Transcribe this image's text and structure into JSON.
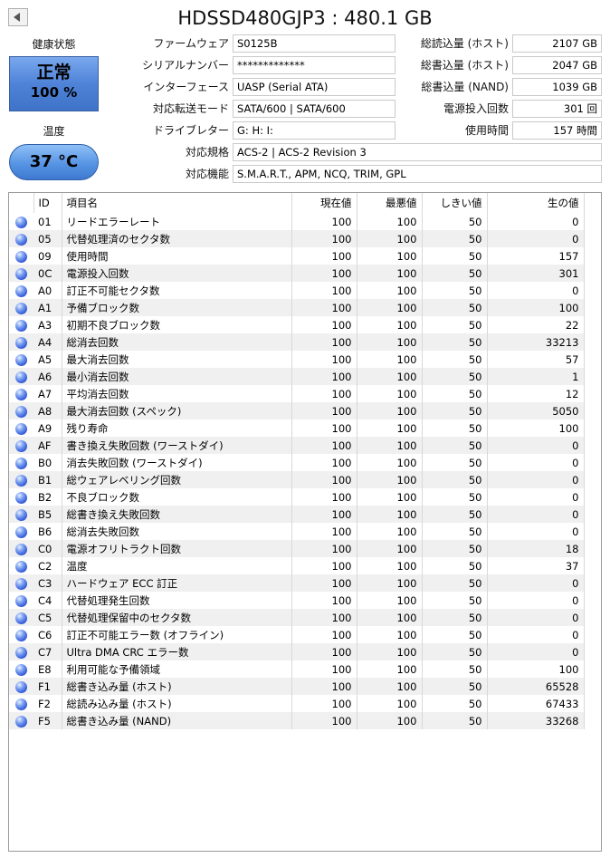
{
  "title": "HDSSD480GJP3 : 480.1 GB",
  "health": {
    "label": "健康状態",
    "status": "正常",
    "percent": "100 %",
    "color": "#4f83d8"
  },
  "temperature": {
    "label": "温度",
    "value": "37 °C",
    "color": "#5794e4"
  },
  "info": {
    "firmware": {
      "label": "ファームウェア",
      "value": "S0125B"
    },
    "serial": {
      "label": "シリアルナンバー",
      "value": "*************"
    },
    "interface": {
      "label": "インターフェース",
      "value": "UASP (Serial ATA)"
    },
    "transfer_mode": {
      "label": "対応転送モード",
      "value": "SATA/600 | SATA/600"
    },
    "drive_letter": {
      "label": "ドライブレター",
      "value": "G: H: I:"
    },
    "standard": {
      "label": "対応規格",
      "value": "ACS-2 | ACS-2 Revision 3"
    },
    "features": {
      "label": "対応機能",
      "value": "S.M.A.R.T., APM, NCQ, TRIM, GPL"
    }
  },
  "stats": {
    "host_reads": {
      "label": "総読込量 (ホスト)",
      "value": "2107 GB"
    },
    "host_writes": {
      "label": "総書込量 (ホスト)",
      "value": "2047 GB"
    },
    "nand_writes": {
      "label": "総書込量 (NAND)",
      "value": "1039 GB"
    },
    "power_on_count": {
      "label": "電源投入回数",
      "value": "301 回"
    },
    "power_on_hours": {
      "label": "使用時間",
      "value": "157 時間"
    }
  },
  "smart": {
    "headers": {
      "id": "ID",
      "name": "項目名",
      "current": "現在値",
      "worst": "最悪値",
      "threshold": "しきい値",
      "raw": "生の値"
    },
    "status_icon": "blue-circle-icon",
    "rows": [
      {
        "id": "01",
        "name": "リードエラーレート",
        "current": "100",
        "worst": "100",
        "threshold": "50",
        "raw": "0"
      },
      {
        "id": "05",
        "name": "代替処理済のセクタ数",
        "current": "100",
        "worst": "100",
        "threshold": "50",
        "raw": "0"
      },
      {
        "id": "09",
        "name": "使用時間",
        "current": "100",
        "worst": "100",
        "threshold": "50",
        "raw": "157"
      },
      {
        "id": "0C",
        "name": "電源投入回数",
        "current": "100",
        "worst": "100",
        "threshold": "50",
        "raw": "301"
      },
      {
        "id": "A0",
        "name": "訂正不可能セクタ数",
        "current": "100",
        "worst": "100",
        "threshold": "50",
        "raw": "0"
      },
      {
        "id": "A1",
        "name": "予備ブロック数",
        "current": "100",
        "worst": "100",
        "threshold": "50",
        "raw": "100"
      },
      {
        "id": "A3",
        "name": "初期不良ブロック数",
        "current": "100",
        "worst": "100",
        "threshold": "50",
        "raw": "22"
      },
      {
        "id": "A4",
        "name": "総消去回数",
        "current": "100",
        "worst": "100",
        "threshold": "50",
        "raw": "33213"
      },
      {
        "id": "A5",
        "name": "最大消去回数",
        "current": "100",
        "worst": "100",
        "threshold": "50",
        "raw": "57"
      },
      {
        "id": "A6",
        "name": "最小消去回数",
        "current": "100",
        "worst": "100",
        "threshold": "50",
        "raw": "1"
      },
      {
        "id": "A7",
        "name": "平均消去回数",
        "current": "100",
        "worst": "100",
        "threshold": "50",
        "raw": "12"
      },
      {
        "id": "A8",
        "name": "最大消去回数 (スペック)",
        "current": "100",
        "worst": "100",
        "threshold": "50",
        "raw": "5050"
      },
      {
        "id": "A9",
        "name": "残り寿命",
        "current": "100",
        "worst": "100",
        "threshold": "50",
        "raw": "100"
      },
      {
        "id": "AF",
        "name": "書き換え失敗回数 (ワーストダイ)",
        "current": "100",
        "worst": "100",
        "threshold": "50",
        "raw": "0"
      },
      {
        "id": "B0",
        "name": "消去失敗回数 (ワーストダイ)",
        "current": "100",
        "worst": "100",
        "threshold": "50",
        "raw": "0"
      },
      {
        "id": "B1",
        "name": "総ウェアレベリング回数",
        "current": "100",
        "worst": "100",
        "threshold": "50",
        "raw": "0"
      },
      {
        "id": "B2",
        "name": "不良ブロック数",
        "current": "100",
        "worst": "100",
        "threshold": "50",
        "raw": "0"
      },
      {
        "id": "B5",
        "name": "総書き換え失敗回数",
        "current": "100",
        "worst": "100",
        "threshold": "50",
        "raw": "0"
      },
      {
        "id": "B6",
        "name": "総消去失敗回数",
        "current": "100",
        "worst": "100",
        "threshold": "50",
        "raw": "0"
      },
      {
        "id": "C0",
        "name": "電源オフリトラクト回数",
        "current": "100",
        "worst": "100",
        "threshold": "50",
        "raw": "18"
      },
      {
        "id": "C2",
        "name": "温度",
        "current": "100",
        "worst": "100",
        "threshold": "50",
        "raw": "37"
      },
      {
        "id": "C3",
        "name": "ハードウェア ECC 訂正",
        "current": "100",
        "worst": "100",
        "threshold": "50",
        "raw": "0"
      },
      {
        "id": "C4",
        "name": "代替処理発生回数",
        "current": "100",
        "worst": "100",
        "threshold": "50",
        "raw": "0"
      },
      {
        "id": "C5",
        "name": "代替処理保留中のセクタ数",
        "current": "100",
        "worst": "100",
        "threshold": "50",
        "raw": "0"
      },
      {
        "id": "C6",
        "name": "訂正不可能エラー数 (オフライン)",
        "current": "100",
        "worst": "100",
        "threshold": "50",
        "raw": "0"
      },
      {
        "id": "C7",
        "name": "Ultra DMA CRC エラー数",
        "current": "100",
        "worst": "100",
        "threshold": "50",
        "raw": "0"
      },
      {
        "id": "E8",
        "name": "利用可能な予備領域",
        "current": "100",
        "worst": "100",
        "threshold": "50",
        "raw": "100"
      },
      {
        "id": "F1",
        "name": "総書き込み量 (ホスト)",
        "current": "100",
        "worst": "100",
        "threshold": "50",
        "raw": "65528"
      },
      {
        "id": "F2",
        "name": "総読み込み量 (ホスト)",
        "current": "100",
        "worst": "100",
        "threshold": "50",
        "raw": "67433"
      },
      {
        "id": "F5",
        "name": "総書き込み量 (NAND)",
        "current": "100",
        "worst": "100",
        "threshold": "50",
        "raw": "33268"
      }
    ]
  }
}
